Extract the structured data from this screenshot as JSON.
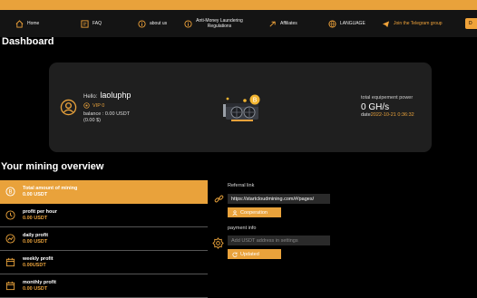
{
  "nav": {
    "home": "Home",
    "faq": "FAQ",
    "about": "about us",
    "aml": "Anti-Money Laundering Regulations",
    "affiliates": "Affiliates",
    "language": "LANGUAGE",
    "telegram": "Join the Telegram group",
    "cta": "D"
  },
  "page_title": "Dashboard",
  "user": {
    "greeting": "Hello:",
    "username": "laoluphp",
    "vip": "VIP 0",
    "balance_usdt": "balance : 0.00 USDT",
    "balance_usd": "(0.00 $)"
  },
  "power": {
    "label": "total equipement power",
    "value": "0 GH/s",
    "date_label": "date",
    "date_value": "2022-10-21 0:36:32"
  },
  "overview_title": "Your mining overview",
  "mining": [
    {
      "label": "Total amount of mining",
      "value": "0.00 USDT",
      "icon": "bitcoin-icon"
    },
    {
      "label": "profit per hour",
      "value": "0.00 USDT",
      "icon": "clock-icon"
    },
    {
      "label": "daily profit",
      "value": "0.00 USDT",
      "icon": "chart-icon"
    },
    {
      "label": "weekly profit",
      "value": "0.00USDT",
      "icon": "calendar-icon"
    },
    {
      "label": "monthly profit",
      "value": "0.00 USDT",
      "icon": "calendar-icon"
    }
  ],
  "referral": {
    "title": "Referral link",
    "url": "https://startcloudmining.com/#/pages/",
    "button": "Cooperation"
  },
  "payment": {
    "title": "payment info",
    "placeholder": "Add USDT address in settings",
    "button": "Updated"
  },
  "colors": {
    "accent": "#e9a23b",
    "card": "#1f1f1f",
    "nav": "#141414"
  }
}
